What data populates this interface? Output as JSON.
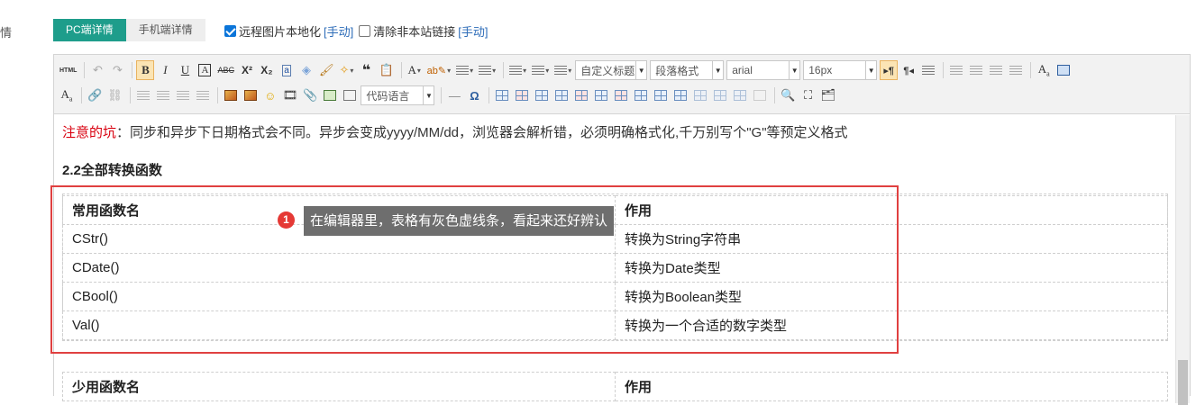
{
  "side_label": "情",
  "tabs": [
    {
      "label": "PC端详情",
      "active": true
    },
    {
      "label": "手机端详情",
      "active": false
    }
  ],
  "options": {
    "localize_label": "远程图片本地化",
    "localize_manual": "[手动]",
    "localize_checked": true,
    "clear_links_label": "清除非本站链接",
    "clear_links_manual": "[手动]",
    "clear_links_checked": false
  },
  "toolbar": {
    "html_label": "HTML",
    "custom_title": "自定义标题",
    "paragraph_format": "段落格式",
    "font_family": "arial",
    "font_size": "16px",
    "code_lang": "代码语言"
  },
  "content": {
    "note_prefix": "注意的坑",
    "note_text": "：同步和异步下日期格式会不同。异步会变成yyyy/MM/dd，浏览器会解析错，必须明确格式化,千万别写个\"G\"等预定义格式",
    "heading": "2.2全部转换函数",
    "table1": {
      "headers": [
        "常用函数名",
        "作用"
      ],
      "rows": [
        [
          "CStr()",
          "转换为String字符串"
        ],
        [
          "CDate()",
          "转换为Date类型"
        ],
        [
          "CBool()",
          "转换为Boolean类型"
        ],
        [
          "Val()",
          "转换为一个合适的数字类型"
        ]
      ]
    },
    "table2": {
      "headers": [
        "少用函数名",
        "作用"
      ]
    }
  },
  "annotation": {
    "badge": "1",
    "text": "在编辑器里，表格有灰色虚线条，看起来还好辨认"
  },
  "colors": {
    "tab_active": "#1e9d8b",
    "highlight_border": "#e04040",
    "note_prefix": "#d9000f",
    "link": "#2d6cb8"
  }
}
